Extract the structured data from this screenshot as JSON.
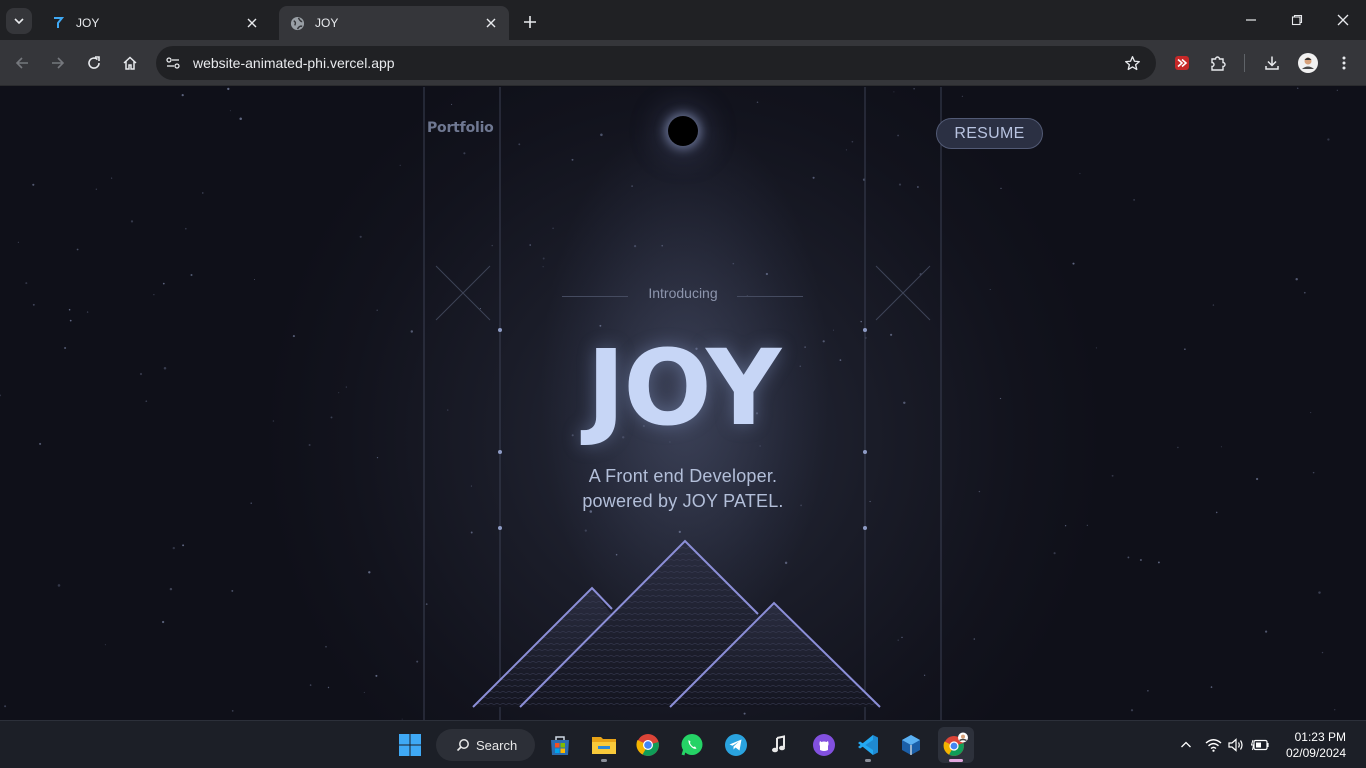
{
  "browser": {
    "tabs": [
      {
        "title": "JOY",
        "active": false,
        "favicon": "joy-logo-icon"
      },
      {
        "title": "JOY",
        "active": true,
        "favicon": "globe-icon"
      }
    ],
    "url": "website-animated-phi.vercel.app"
  },
  "page": {
    "logo": "Portfolio",
    "resume_button": "RESUME",
    "intro": "Introducing",
    "hero_title": "JOY",
    "tagline_1": "A Front end Developer.",
    "tagline_2": "powered by JOY PATEL.",
    "colors": {
      "background": "#0f1019",
      "hero": "#c7d6f6",
      "accent_line": "#8c8fd8"
    }
  },
  "taskbar": {
    "search_label": "Search",
    "apps": [
      "windows-start-icon",
      "microsoft-store-icon",
      "file-explorer-icon",
      "chrome-icon",
      "whatsapp-icon",
      "telegram-icon",
      "music-app-icon",
      "github-desktop-icon",
      "vscode-icon",
      "virtualbox-icon",
      "chrome-profile-icon"
    ],
    "time": "01:23 PM",
    "date": "02/09/2024"
  }
}
